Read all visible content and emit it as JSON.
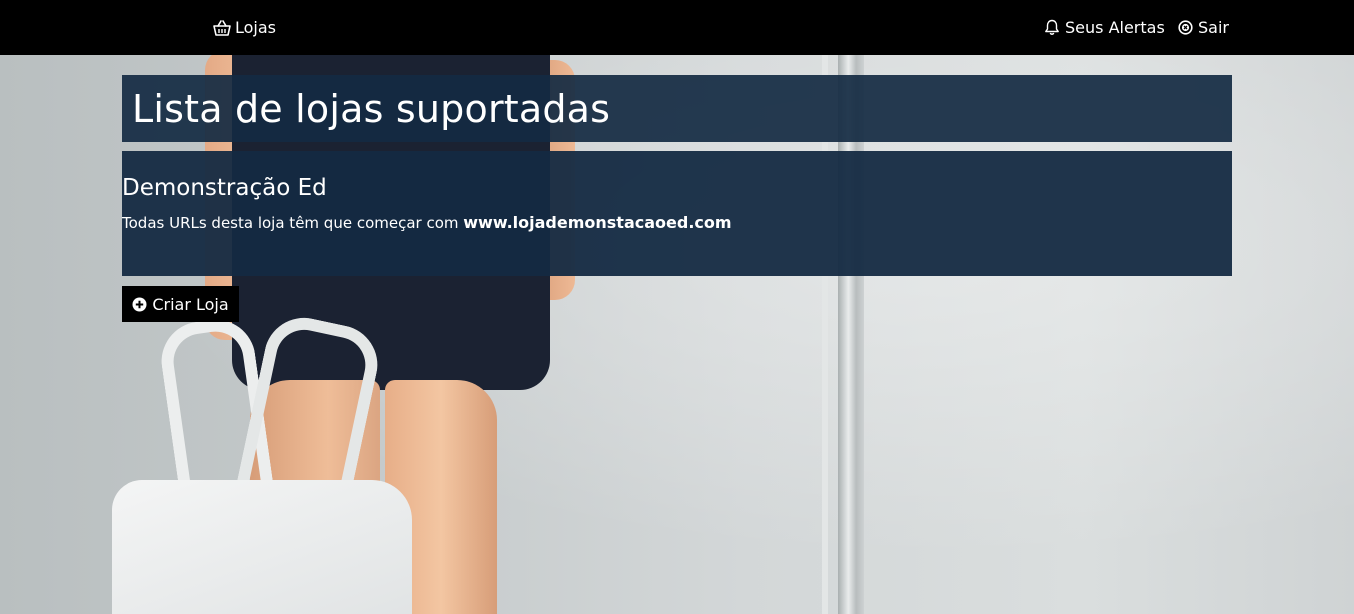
{
  "nav": {
    "stores_label": "Lojas",
    "alerts_label": "Seus Alertas",
    "logout_label": "Sair",
    "stores_icon": "shopping-basket-icon",
    "alerts_icon": "bell-icon",
    "logout_icon": "times-circle-icon"
  },
  "page": {
    "title": "Lista de lojas suportadas"
  },
  "stores": [
    {
      "name": "Demonstração Ed",
      "description_prefix": "Todas URLs desta loja têm que começar com ",
      "url": "www.lojademonstacaoed.com"
    }
  ],
  "actions": {
    "create_store_label": "Criar Loja",
    "create_store_icon": "plus-circle-icon"
  },
  "colors": {
    "navbar_bg": "#000000",
    "panel_bg": "#142a42",
    "text": "#ffffff"
  }
}
